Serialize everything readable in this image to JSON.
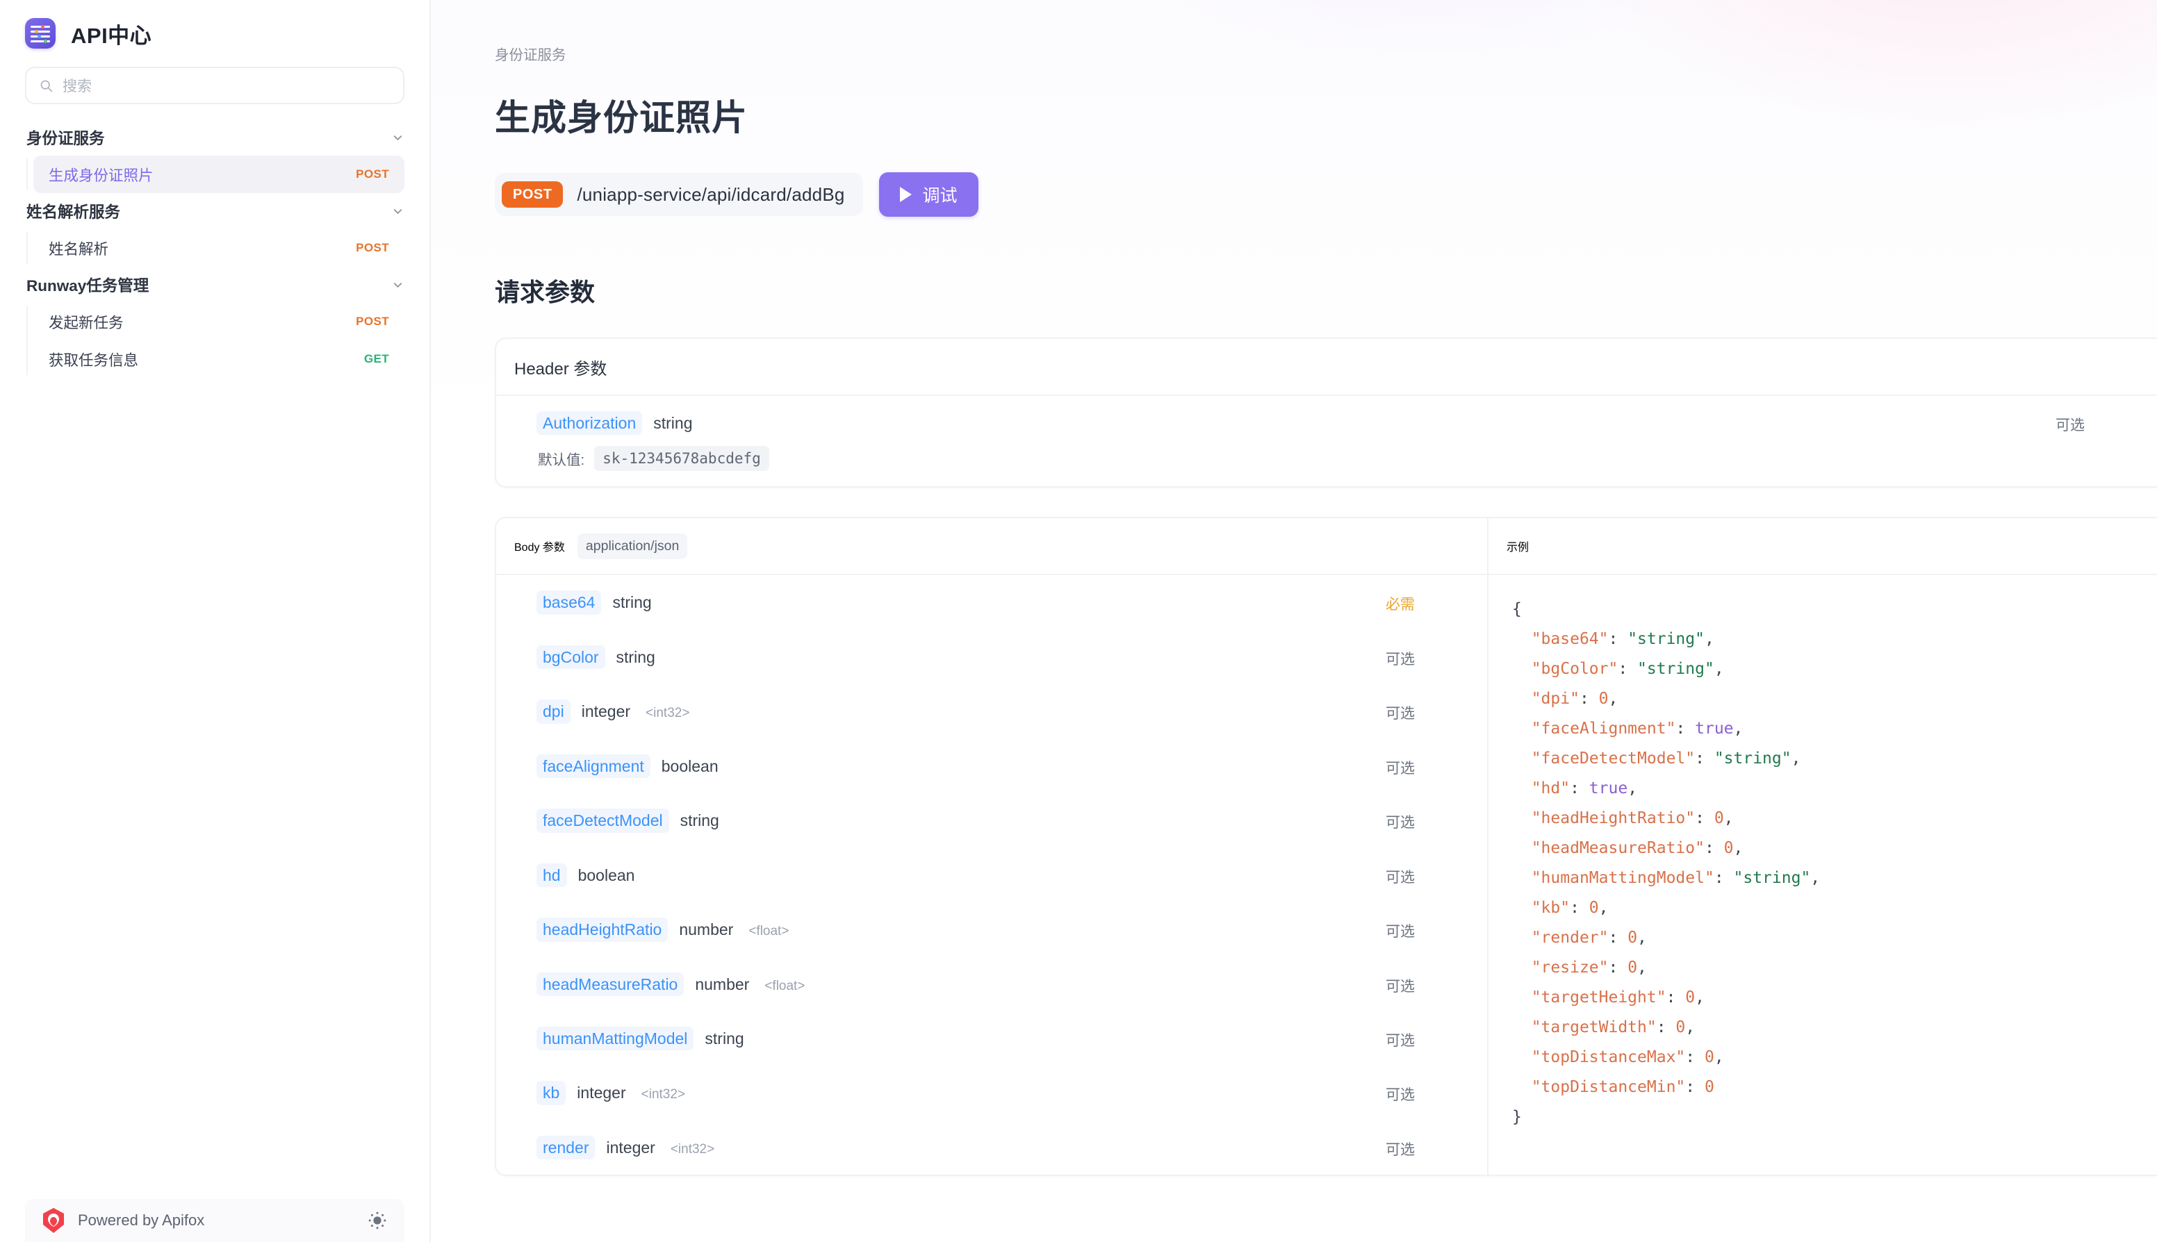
{
  "sidebar": {
    "brand_title": "API中心",
    "search": {
      "placeholder": "搜索",
      "icon": "search-icon"
    },
    "groups": [
      {
        "title": "身份证服务",
        "items": [
          {
            "label": "生成身份证照片",
            "method": "POST",
            "active": true
          }
        ]
      },
      {
        "title": "姓名解析服务",
        "items": [
          {
            "label": "姓名解析",
            "method": "POST",
            "active": false
          }
        ]
      },
      {
        "title": "Runway任务管理",
        "items": [
          {
            "label": "发起新任务",
            "method": "POST",
            "active": false
          },
          {
            "label": "获取任务信息",
            "method": "GET",
            "active": false
          }
        ]
      }
    ],
    "footer": {
      "label": "Powered by Apifox",
      "theme_icon": "sun-icon"
    }
  },
  "main": {
    "breadcrumb": "身份证服务",
    "page_title": "生成身份证照片",
    "endpoint": {
      "method": "POST",
      "path": "/uniapp-service/api/idcard/addBg"
    },
    "debug_button": "调试",
    "request_section_title": "请求参数",
    "header_card": {
      "title": "Header 参数",
      "rows": [
        {
          "name": "Authorization",
          "type": "string",
          "format": "",
          "required_label": "可选",
          "required": false,
          "default_label": "默认值:",
          "default_value": "sk-12345678abcdefg"
        }
      ]
    },
    "body_card": {
      "title": "Body 参数",
      "mime": "application/json",
      "rows": [
        {
          "name": "base64",
          "type": "string",
          "format": "",
          "required_label": "必需",
          "required": true
        },
        {
          "name": "bgColor",
          "type": "string",
          "format": "",
          "required_label": "可选",
          "required": false
        },
        {
          "name": "dpi",
          "type": "integer",
          "format": "<int32>",
          "required_label": "可选",
          "required": false
        },
        {
          "name": "faceAlignment",
          "type": "boolean",
          "format": "",
          "required_label": "可选",
          "required": false
        },
        {
          "name": "faceDetectModel",
          "type": "string",
          "format": "",
          "required_label": "可选",
          "required": false
        },
        {
          "name": "hd",
          "type": "boolean",
          "format": "",
          "required_label": "可选",
          "required": false
        },
        {
          "name": "headHeightRatio",
          "type": "number",
          "format": "<float>",
          "required_label": "可选",
          "required": false
        },
        {
          "name": "headMeasureRatio",
          "type": "number",
          "format": "<float>",
          "required_label": "可选",
          "required": false
        },
        {
          "name": "humanMattingModel",
          "type": "string",
          "format": "",
          "required_label": "可选",
          "required": false
        },
        {
          "name": "kb",
          "type": "integer",
          "format": "<int32>",
          "required_label": "可选",
          "required": false
        },
        {
          "name": "render",
          "type": "integer",
          "format": "<int32>",
          "required_label": "可选",
          "required": false
        }
      ]
    },
    "example_panel": {
      "title": "示例",
      "json_lines": [
        {
          "indent": 0,
          "tokens": [
            {
              "t": "brace",
              "v": "{"
            }
          ]
        },
        {
          "indent": 1,
          "tokens": [
            {
              "t": "key",
              "v": "\"base64\""
            },
            {
              "t": "punc",
              "v": ": "
            },
            {
              "t": "str",
              "v": "\"string\""
            },
            {
              "t": "punc",
              "v": ","
            }
          ]
        },
        {
          "indent": 1,
          "tokens": [
            {
              "t": "key",
              "v": "\"bgColor\""
            },
            {
              "t": "punc",
              "v": ": "
            },
            {
              "t": "str",
              "v": "\"string\""
            },
            {
              "t": "punc",
              "v": ","
            }
          ]
        },
        {
          "indent": 1,
          "tokens": [
            {
              "t": "key",
              "v": "\"dpi\""
            },
            {
              "t": "punc",
              "v": ": "
            },
            {
              "t": "num",
              "v": "0"
            },
            {
              "t": "punc",
              "v": ","
            }
          ]
        },
        {
          "indent": 1,
          "tokens": [
            {
              "t": "key",
              "v": "\"faceAlignment\""
            },
            {
              "t": "punc",
              "v": ": "
            },
            {
              "t": "bool",
              "v": "true"
            },
            {
              "t": "punc",
              "v": ","
            }
          ]
        },
        {
          "indent": 1,
          "tokens": [
            {
              "t": "key",
              "v": "\"faceDetectModel\""
            },
            {
              "t": "punc",
              "v": ": "
            },
            {
              "t": "str",
              "v": "\"string\""
            },
            {
              "t": "punc",
              "v": ","
            }
          ]
        },
        {
          "indent": 1,
          "tokens": [
            {
              "t": "key",
              "v": "\"hd\""
            },
            {
              "t": "punc",
              "v": ": "
            },
            {
              "t": "bool",
              "v": "true"
            },
            {
              "t": "punc",
              "v": ","
            }
          ]
        },
        {
          "indent": 1,
          "tokens": [
            {
              "t": "key",
              "v": "\"headHeightRatio\""
            },
            {
              "t": "punc",
              "v": ": "
            },
            {
              "t": "num",
              "v": "0"
            },
            {
              "t": "punc",
              "v": ","
            }
          ]
        },
        {
          "indent": 1,
          "tokens": [
            {
              "t": "key",
              "v": "\"headMeasureRatio\""
            },
            {
              "t": "punc",
              "v": ": "
            },
            {
              "t": "num",
              "v": "0"
            },
            {
              "t": "punc",
              "v": ","
            }
          ]
        },
        {
          "indent": 1,
          "tokens": [
            {
              "t": "key",
              "v": "\"humanMattingModel\""
            },
            {
              "t": "punc",
              "v": ": "
            },
            {
              "t": "str",
              "v": "\"string\""
            },
            {
              "t": "punc",
              "v": ","
            }
          ]
        },
        {
          "indent": 1,
          "tokens": [
            {
              "t": "key",
              "v": "\"kb\""
            },
            {
              "t": "punc",
              "v": ": "
            },
            {
              "t": "num",
              "v": "0"
            },
            {
              "t": "punc",
              "v": ","
            }
          ]
        },
        {
          "indent": 1,
          "tokens": [
            {
              "t": "key",
              "v": "\"render\""
            },
            {
              "t": "punc",
              "v": ": "
            },
            {
              "t": "num",
              "v": "0"
            },
            {
              "t": "punc",
              "v": ","
            }
          ]
        },
        {
          "indent": 1,
          "tokens": [
            {
              "t": "key",
              "v": "\"resize\""
            },
            {
              "t": "punc",
              "v": ": "
            },
            {
              "t": "num",
              "v": "0"
            },
            {
              "t": "punc",
              "v": ","
            }
          ]
        },
        {
          "indent": 1,
          "tokens": [
            {
              "t": "key",
              "v": "\"targetHeight\""
            },
            {
              "t": "punc",
              "v": ": "
            },
            {
              "t": "num",
              "v": "0"
            },
            {
              "t": "punc",
              "v": ","
            }
          ]
        },
        {
          "indent": 1,
          "tokens": [
            {
              "t": "key",
              "v": "\"targetWidth\""
            },
            {
              "t": "punc",
              "v": ": "
            },
            {
              "t": "num",
              "v": "0"
            },
            {
              "t": "punc",
              "v": ","
            }
          ]
        },
        {
          "indent": 1,
          "tokens": [
            {
              "t": "key",
              "v": "\"topDistanceMax\""
            },
            {
              "t": "punc",
              "v": ": "
            },
            {
              "t": "num",
              "v": "0"
            },
            {
              "t": "punc",
              "v": ","
            }
          ]
        },
        {
          "indent": 1,
          "tokens": [
            {
              "t": "key",
              "v": "\"topDistanceMin\""
            },
            {
              "t": "punc",
              "v": ": "
            },
            {
              "t": "num",
              "v": "0"
            }
          ]
        },
        {
          "indent": 0,
          "tokens": [
            {
              "t": "brace",
              "v": "}"
            }
          ]
        }
      ]
    }
  },
  "colors": {
    "method_post": "#e8732b",
    "method_get": "#28b473",
    "accent_purple": "#8a71f0",
    "post_badge_bg": "#ee6a22",
    "param_name": "#3b93f7",
    "required_flag": "#e8a42b",
    "optional_flag": "#6c737f"
  }
}
